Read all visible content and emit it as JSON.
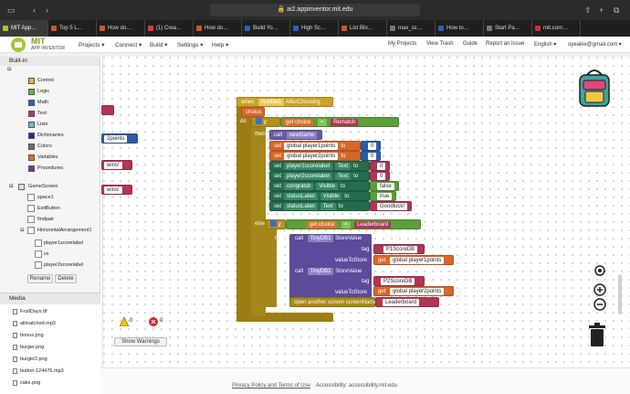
{
  "browser": {
    "url": "ai2.appinventor.mit.edu",
    "tabs": [
      "MIT App…",
      "Top 5 L…",
      "How do…",
      "(1) Crea…",
      "How do…",
      "Build Yo…",
      "High Sc…",
      "List Blo…",
      "max_sc…",
      "How to…",
      "Start Pa…",
      "mit.com…"
    ]
  },
  "app": {
    "brand_line1": "MIT",
    "brand_line2": "APP INVENTOR",
    "menus": {
      "projects": "Projects ▾",
      "connect": "Connect ▾",
      "build": "Build ▾",
      "settings": "Settings ▾",
      "help": "Help ▾"
    },
    "right": {
      "my_projects": "My Projects",
      "view_trash": "View Trash",
      "guide": "Guide",
      "report": "Report an Issue",
      "language": "English ▾",
      "user": "oyeakie@gmail.com ▾"
    }
  },
  "blocks_panel": {
    "header": "Built-in",
    "builtins": [
      {
        "label": "Control",
        "color": "#e3b43a"
      },
      {
        "label": "Logic",
        "color": "#72b23a"
      },
      {
        "label": "Math",
        "color": "#2f62b0"
      },
      {
        "label": "Text",
        "color": "#b73a55"
      },
      {
        "label": "Lists",
        "color": "#76b4e6"
      },
      {
        "label": "Dictionaries",
        "color": "#2b2b84"
      },
      {
        "label": "Colors",
        "color": "#6e6e6e"
      },
      {
        "label": "Variables",
        "color": "#e46b2a"
      },
      {
        "label": "Procedures",
        "color": "#7a3a8a"
      }
    ],
    "screen": "GameScreen",
    "components": [
      "space1",
      "ExitButton",
      "findpair",
      "HorizontalArrangement1"
    ],
    "subcomponents": [
      "player1scorelabel",
      "vs",
      "player2scorelabel"
    ],
    "rename_label": "Rename",
    "delete_label": "Delete"
  },
  "media": {
    "header": "Media",
    "files": [
      "FruitDays.ttf",
      "allmatched.mp3",
      "bonus.png",
      "burger.png",
      "burger2.png",
      "button-124476.mp3",
      "cake.png"
    ]
  },
  "workspace": {
    "left_fragments": [
      "2points",
      "wins!",
      "wins!"
    ],
    "event": {
      "when": "when",
      "component": "Notifier1",
      "event": "AfterChoosing",
      "param": "choice"
    },
    "do_label": "do",
    "if_label": "if",
    "then_label": "then",
    "else_label": "else",
    "get_label": "get",
    "choice_var": "choice",
    "eq_op": "=",
    "rematch_text": "Rematch",
    "call_label": "call",
    "new_game": "newGame",
    "set_label": "set",
    "to_label": "to",
    "global_p1": "global player1points",
    "global_p2": "global player2points",
    "zero": "0",
    "p1_label": "player1scorelabel",
    "p2_label": "player2scorelabel",
    "congratsb": "congratsb",
    "status_label": "statusLabel",
    "text_prop": "Text",
    "visible_prop": "Visible",
    "false_val": "false",
    "true_val": "true",
    "goodluck": "Goodluck!",
    "leaderboard": "Leaderboard",
    "tinydb": "TinyDB1",
    "store_value": "StoreValue",
    "tag_label": "tag",
    "value_to_store": "valueToStore",
    "tag1": "P1ScoreDB",
    "tag2": "P2ScoreDB",
    "open_screen": "open another screen",
    "screen_name": "screenName",
    "warnings_count": "0",
    "errors_count": "0",
    "show_warnings": "Show Warnings"
  },
  "footer": {
    "privacy": "Privacy Policy and Terms of Use",
    "accessibility": "Accessibility: accessibility.mit.edu"
  }
}
